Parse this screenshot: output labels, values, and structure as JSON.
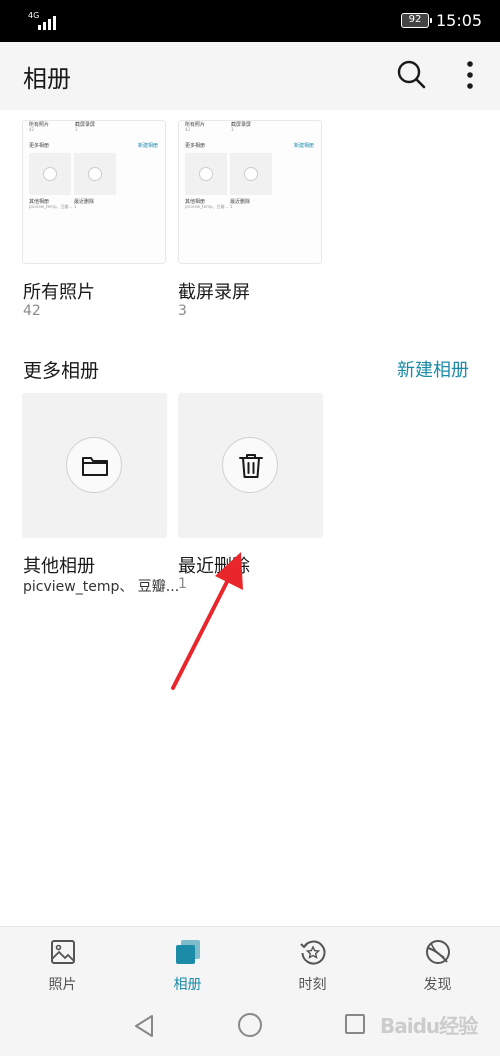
{
  "status_bar": {
    "network": "4G",
    "battery": "92",
    "time": "15:05"
  },
  "header": {
    "title": "相册"
  },
  "albums": [
    {
      "name": "所有照片",
      "count": "42"
    },
    {
      "name": "截屏录屏",
      "count": "3"
    }
  ],
  "thumbnail_preview": {
    "all_photos": "所有照片",
    "all_count": "42",
    "screenshots": "截屏录屏",
    "screens_count": "3",
    "more_albums": "更多相册",
    "new_album": "新建相册",
    "other": "其他相册",
    "other_sub": "picview_temp、豆瓣...",
    "recent": "最近删除",
    "recent_count": "1"
  },
  "more_albums": {
    "title": "更多相册",
    "new_album_label": "新建相册",
    "items": [
      {
        "name": "其他相册",
        "subtitle": "picview_temp、 豆瓣...",
        "icon": "folder-icon"
      },
      {
        "name": "最近删除",
        "subtitle": "1",
        "icon": "trash-icon"
      }
    ]
  },
  "bottom_nav": [
    {
      "label": "照片",
      "icon": "photo-icon",
      "active": false
    },
    {
      "label": "相册",
      "icon": "album-icon",
      "active": true
    },
    {
      "label": "时刻",
      "icon": "moments-icon",
      "active": false
    },
    {
      "label": "发现",
      "icon": "discover-icon",
      "active": false
    }
  ],
  "watermark": "Baidu经验",
  "colors": {
    "accent": "#1b8ba8",
    "annotation_arrow": "#e8262b"
  }
}
